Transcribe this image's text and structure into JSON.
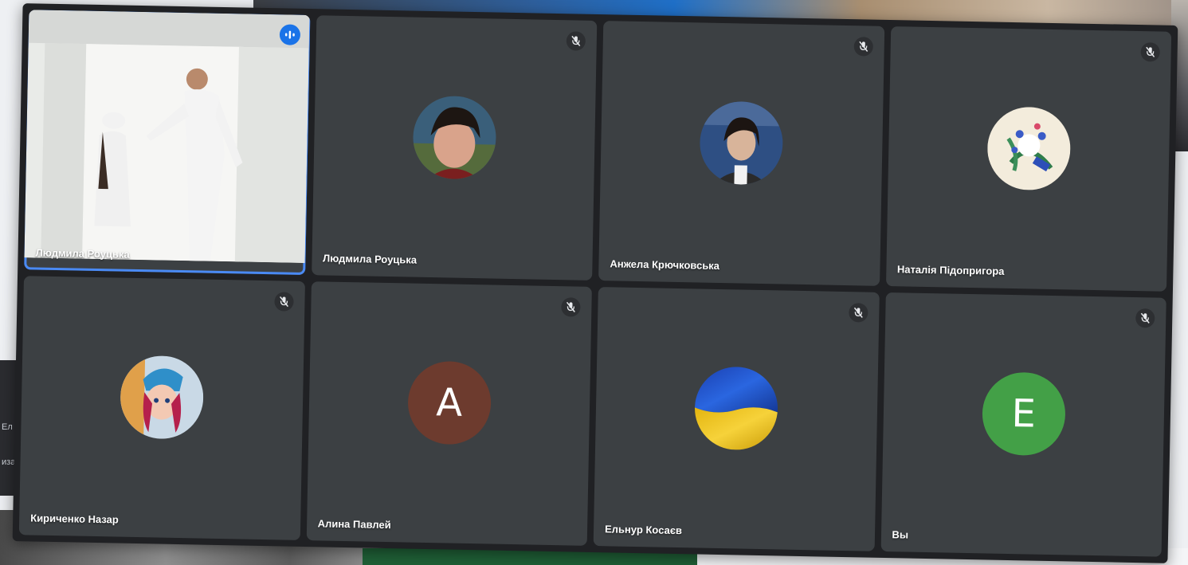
{
  "background": {
    "left_fragments": [
      "Ел",
      "иза"
    ]
  },
  "participants": [
    {
      "name": "Людмила Роуцька",
      "type": "video",
      "active_speaker": true,
      "icon": "speaking-indicator-icon"
    },
    {
      "name": "Людмила Роуцька",
      "type": "photo",
      "icon": "mic-off-icon"
    },
    {
      "name": "Анжела Крючковська",
      "type": "photo",
      "icon": "mic-off-icon"
    },
    {
      "name": "Наталія Підопригора",
      "type": "flowers",
      "icon": "mic-off-icon"
    },
    {
      "name": "Кириченко Назар",
      "type": "anime",
      "icon": "mic-off-icon"
    },
    {
      "name": "Алина Павлей",
      "type": "letter",
      "letter": "A",
      "color": "#6d3b2e",
      "icon": "mic-off-icon"
    },
    {
      "name": "Ельнур Косаєв",
      "type": "flag",
      "icon": "mic-off-icon"
    },
    {
      "name": "Вы",
      "type": "letter",
      "letter": "E",
      "color": "#43a047",
      "icon": "mic-off-icon"
    }
  ],
  "colors": {
    "tile_bg": "#3c4043",
    "window_bg": "#202124",
    "active_outline": "#4a8af4"
  }
}
